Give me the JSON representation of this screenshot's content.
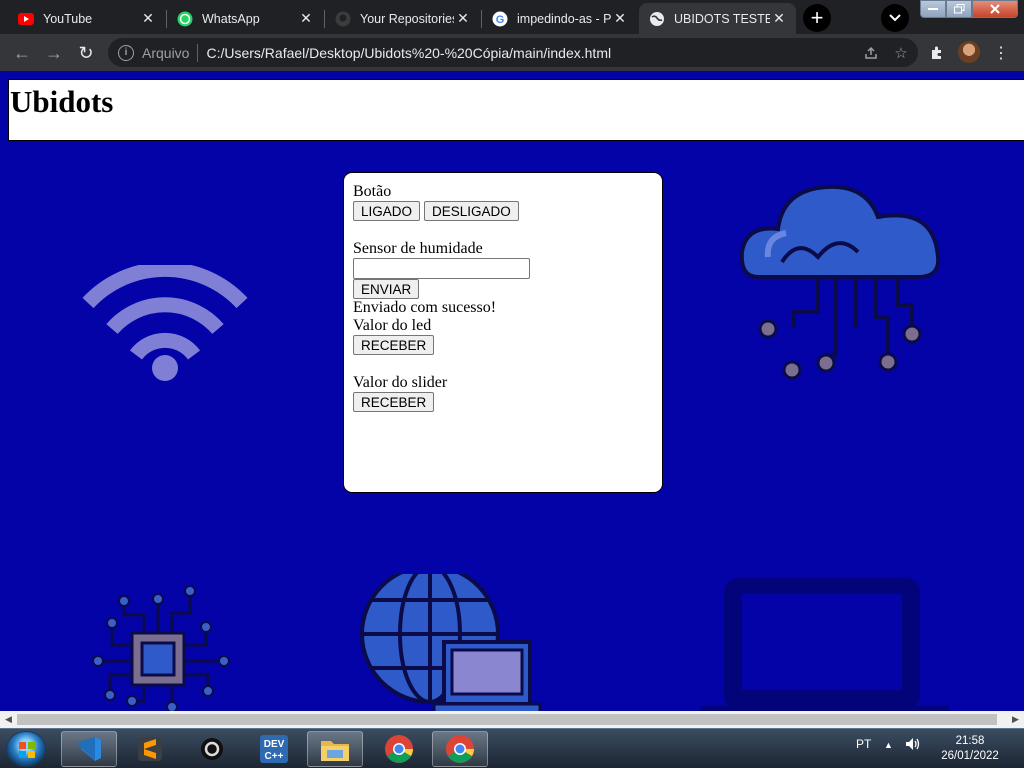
{
  "browser": {
    "tabs": [
      {
        "title": "YouTube",
        "icon": "youtube-icon"
      },
      {
        "title": "WhatsApp",
        "icon": "whatsapp-icon"
      },
      {
        "title": "Your Repositories",
        "icon": "github-icon"
      },
      {
        "title": "impedindo-as - P",
        "icon": "google-icon"
      },
      {
        "title": "UBIDOTS TESTER",
        "icon": "globe-icon",
        "active": true
      }
    ],
    "address": {
      "scheme": "Arquivo",
      "url": "C:/Users/Rafael/Desktop/Ubidots%20-%20Cópia/main/index.html"
    }
  },
  "page": {
    "header_title": "Ubidots",
    "background_color": "#0303a8",
    "panel": {
      "button_label": "Botão",
      "on_button": "LIGADO",
      "off_button": "DESLIGADO",
      "humidity_label": "Sensor de humidade",
      "humidity_value": "",
      "send_button": "ENVIAR",
      "status_message": "Enviado com sucesso!",
      "led_label": "Valor do led",
      "led_receive_button": "RECEBER",
      "slider_label": "Valor do slider",
      "slider_receive_button": "RECEBER"
    }
  },
  "taskbar": {
    "language": "PT",
    "time": "21:58",
    "date": "26/01/2022",
    "apps": [
      "vscode-icon",
      "sublime-text-icon",
      "obs-icon",
      "dev-cpp-icon",
      "file-explorer-icon",
      "chrome-icon",
      "chrome-icon"
    ]
  }
}
